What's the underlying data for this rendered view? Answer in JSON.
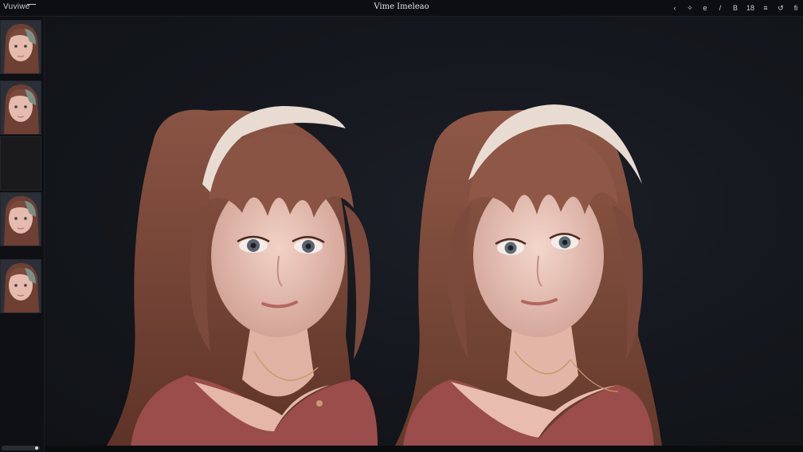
{
  "app": {
    "name": "Vuviwe",
    "title": "Vime Imeleao"
  },
  "toolbar": {
    "icons": [
      "back-arrow-icon",
      "sparkle-icon",
      "circle-e-icon",
      "pen-icon",
      "box-icon",
      "grid-icon",
      "menu-icon",
      "refresh-icon",
      "info-icon"
    ],
    "glyphs": [
      "‹",
      "✧",
      "e",
      "/",
      "B",
      "18",
      "≡",
      "↺",
      "fi"
    ]
  },
  "filmstrip": {
    "thumbnails": [
      {
        "kind": "portrait"
      },
      {
        "kind": "portrait"
      },
      {
        "kind": "empty"
      },
      {
        "kind": "portrait"
      },
      {
        "kind": "portrait"
      }
    ]
  },
  "canvas": {
    "images": [
      {
        "name": "left-portrait"
      },
      {
        "name": "right-portrait"
      }
    ]
  },
  "colors": {
    "hair": "#7b4a3c",
    "hair_light": "#a56a55",
    "skin": "#eac3b4",
    "headband": "#e8dcd2",
    "sweater": "#9a4d4a",
    "background": "#14171d"
  }
}
